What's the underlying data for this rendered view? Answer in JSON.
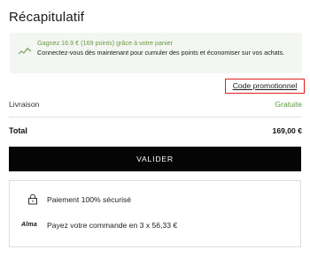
{
  "summary": {
    "title": "Récapitulatif"
  },
  "loyalty": {
    "headline": "Gagnez 16.9 € (169 points) grâce à votre panier",
    "message": "Connectez-vous dès maintenant pour cumuler des points et économiser sur vos achats."
  },
  "promo": {
    "link_label": "Code promotionnel"
  },
  "delivery": {
    "label": "Livraison",
    "value": "Gratuite"
  },
  "total": {
    "label": "Total",
    "value": "169,00 €"
  },
  "actions": {
    "validate_label": "VALIDER"
  },
  "assurances": {
    "secure_payment": "Paiement 100% sécurisé",
    "alma_logo": "Alma",
    "alma_installments": "Payez votre commande en 3 x 56,33 €"
  },
  "colors": {
    "accent_green": "#5a9a3a",
    "highlight_red": "#e31c1c",
    "button_black": "#050505"
  }
}
